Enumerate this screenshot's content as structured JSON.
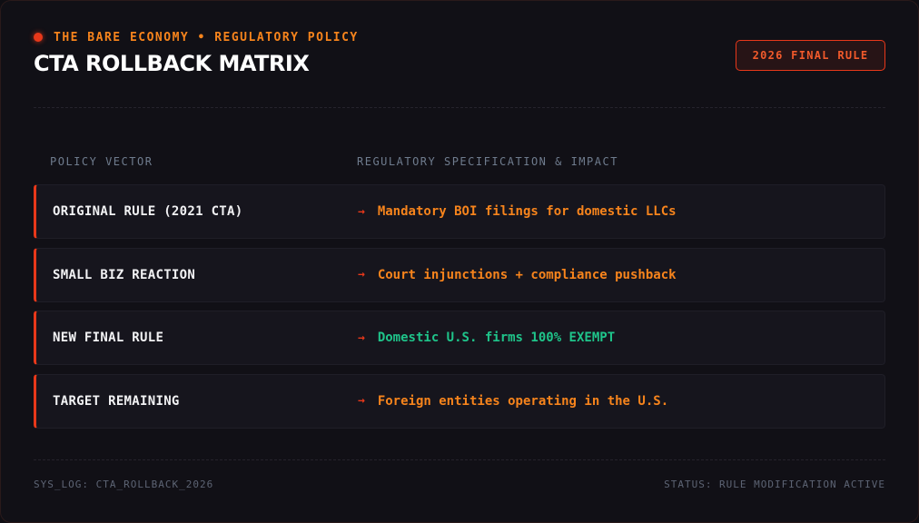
{
  "header": {
    "kicker": "THE BARE ECONOMY • REGULATORY POLICY",
    "title": "CTA ROLLBACK MATRIX",
    "badge": "2026 FINAL RULE"
  },
  "table": {
    "columns": [
      "POLICY VECTOR",
      "REGULATORY SPECIFICATION & IMPACT"
    ],
    "rows": [
      {
        "label": "ORIGINAL RULE (2021 CTA)",
        "arrow": "→",
        "impact": "Mandatory BOI filings for domestic LLCs"
      },
      {
        "label": "SMALL BIZ REACTION",
        "arrow": "→",
        "impact": "Court injunctions + compliance pushback"
      },
      {
        "label": "NEW FINAL RULE",
        "arrow": "→",
        "impact": "Domestic U.S. firms 100% EXEMPT"
      },
      {
        "label": "TARGET REMAINING",
        "arrow": "→",
        "impact": "Foreign entities operating in the U.S."
      }
    ]
  },
  "footer": {
    "left": "SYS_LOG: CTA_ROLLBACK_2026",
    "right": "STATUS: RULE MODIFICATION ACTIVE"
  },
  "colors": {
    "accent_red": "#e8381a",
    "accent_orange": "#f7841c",
    "accent_green": "#1fc48a",
    "background": "#111016"
  }
}
